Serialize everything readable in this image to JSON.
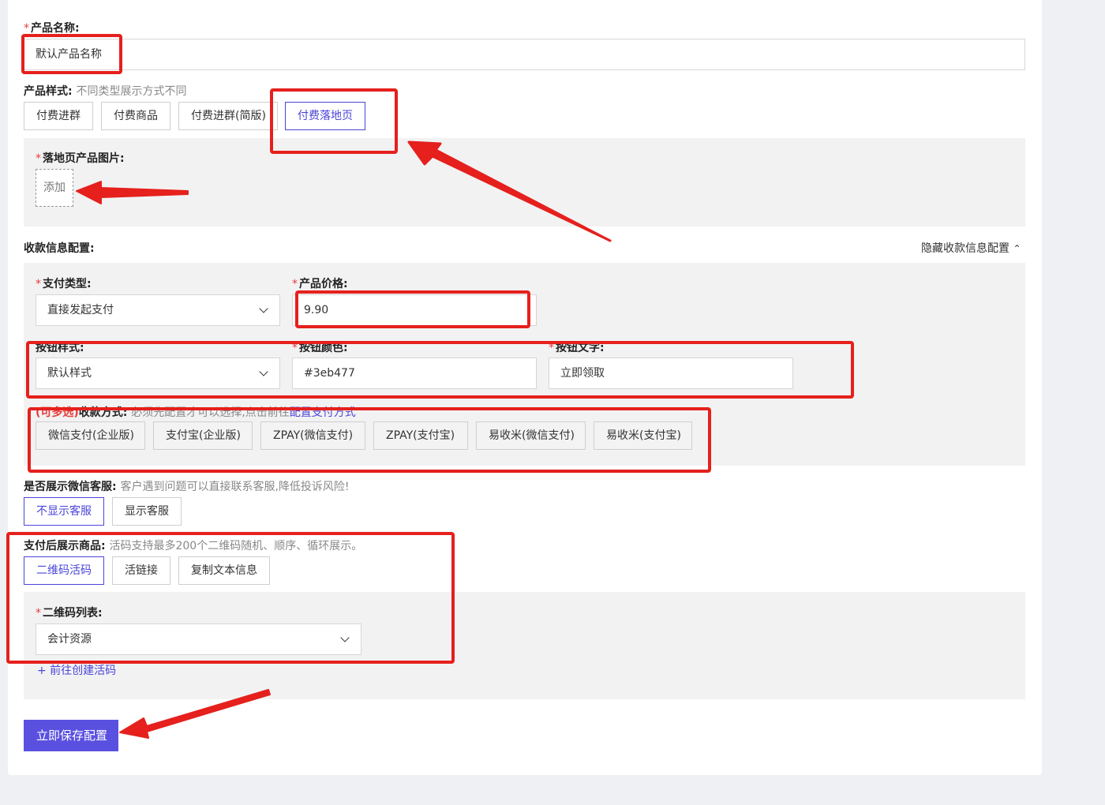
{
  "product_name": {
    "label": "产品名称:",
    "value": "默认产品名称"
  },
  "product_style": {
    "label": "产品样式:",
    "hint": "不同类型展示方式不同",
    "options": [
      "付费进群",
      "付费商品",
      "付费进群(简版)",
      "付费落地页"
    ]
  },
  "landing_image": {
    "label": "落地页产品图片:",
    "add_label": "添加"
  },
  "payment_config": {
    "label": "收款信息配置:",
    "toggle_label": "隐藏收款信息配置"
  },
  "pay_type": {
    "label": "支付类型:",
    "value": "直接发起支付"
  },
  "price": {
    "label": "产品价格:",
    "value": "9.90"
  },
  "button_style": {
    "label": "按钮样式:",
    "value": "默认样式"
  },
  "button_color": {
    "label": "按钮颜色:",
    "value": "#3eb477"
  },
  "button_text": {
    "label": "按钮文字:",
    "value": "立即领取"
  },
  "collect_method": {
    "multi_tag": "(可多选)",
    "label": "收款方式:",
    "hint": "必须先配置才可以选择,点击前往",
    "link": "配置支付方式",
    "options": [
      "微信支付(企业版)",
      "支付宝(企业版)",
      "ZPAY(微信支付)",
      "ZPAY(支付宝)",
      "易收米(微信支付)",
      "易收米(支付宝)"
    ]
  },
  "wechat_service": {
    "label": "是否展示微信客服:",
    "hint": "客户遇到问题可以直接联系客服,降低投诉风险!",
    "options": [
      "不显示客服",
      "显示客服"
    ]
  },
  "after_pay": {
    "label": "支付后展示商品:",
    "hint": "活码支持最多200个二维码随机、顺序、循环展示。",
    "options": [
      "二维码活码",
      "活链接",
      "复制文本信息"
    ]
  },
  "qr_list": {
    "label": "二维码列表:",
    "value": "会计资源",
    "create_link": "+ 前往创建活码"
  },
  "save_button": "立即保存配置",
  "colors": {
    "accent": "#4a46d8",
    "primary": "#5a50e0",
    "annotation": "#e5201d",
    "required": "#e63c3c"
  }
}
